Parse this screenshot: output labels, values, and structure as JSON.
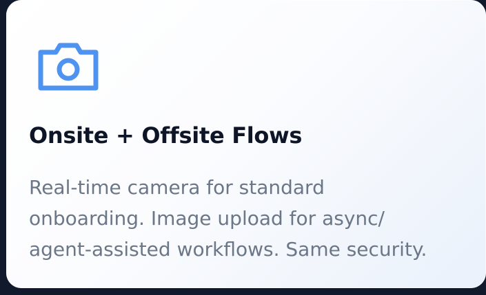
{
  "card": {
    "icon": "camera-icon",
    "accent_color": "#4f93f0",
    "title": "Onsite + Offsite Flows",
    "description_lines": [
      "Real-time camera for standard",
      "onboarding. Image upload for async/",
      "agent-assisted workflows. Same security."
    ]
  }
}
